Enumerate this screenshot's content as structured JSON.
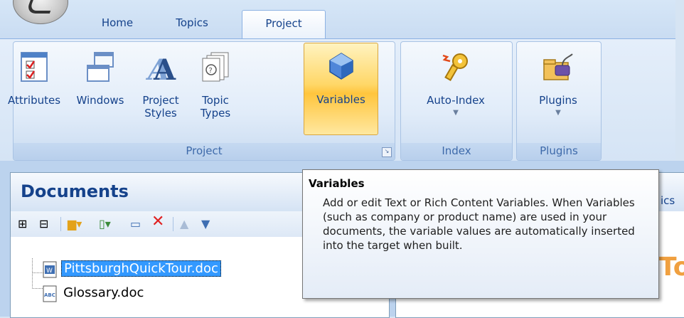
{
  "tabs": [
    {
      "label": "Home"
    },
    {
      "label": "Topics"
    },
    {
      "label": "Project"
    }
  ],
  "ribbon": {
    "project_group": {
      "label": "Project",
      "buttons": [
        {
          "label_1": "Attributes",
          "label_2": "",
          "icon": "checklist-icon"
        },
        {
          "label_1": "Windows",
          "label_2": "",
          "icon": "windows-icon"
        },
        {
          "label_1": "Project",
          "label_2": "Styles",
          "icon": "styles-icon"
        },
        {
          "label_1": "Topic",
          "label_2": "Types",
          "icon": "topic-types-icon"
        },
        {
          "label_1": "Variables",
          "label_2": "",
          "icon": "variables-icon"
        }
      ]
    },
    "index_group": {
      "label": "Index",
      "button": "Auto-Index",
      "icon": "key-icon"
    },
    "plugins_group": {
      "label": "Plugins",
      "button": "Plugins",
      "icon": "plugin-icon"
    }
  },
  "documents": {
    "title": "Documents",
    "files": [
      {
        "name": "PittsburghQuickTour.doc",
        "selected": true,
        "icon": "word-doc-icon"
      },
      {
        "name": "Glossary.doc",
        "selected": false,
        "icon": "glossary-doc-icon"
      }
    ]
  },
  "right_pane": {
    "header_fragment": "ics",
    "big_text_fragment": "To"
  },
  "tooltip": {
    "title": "Variables",
    "body": "Add or edit Text or Rich Content Variables. When Variables (such as company or product name) are used in your documents, the variable values are automatically inserted into the target when built."
  },
  "colors": {
    "accent": "#15428b",
    "selection": "#3399ff",
    "highlight": "#ffc53d"
  }
}
